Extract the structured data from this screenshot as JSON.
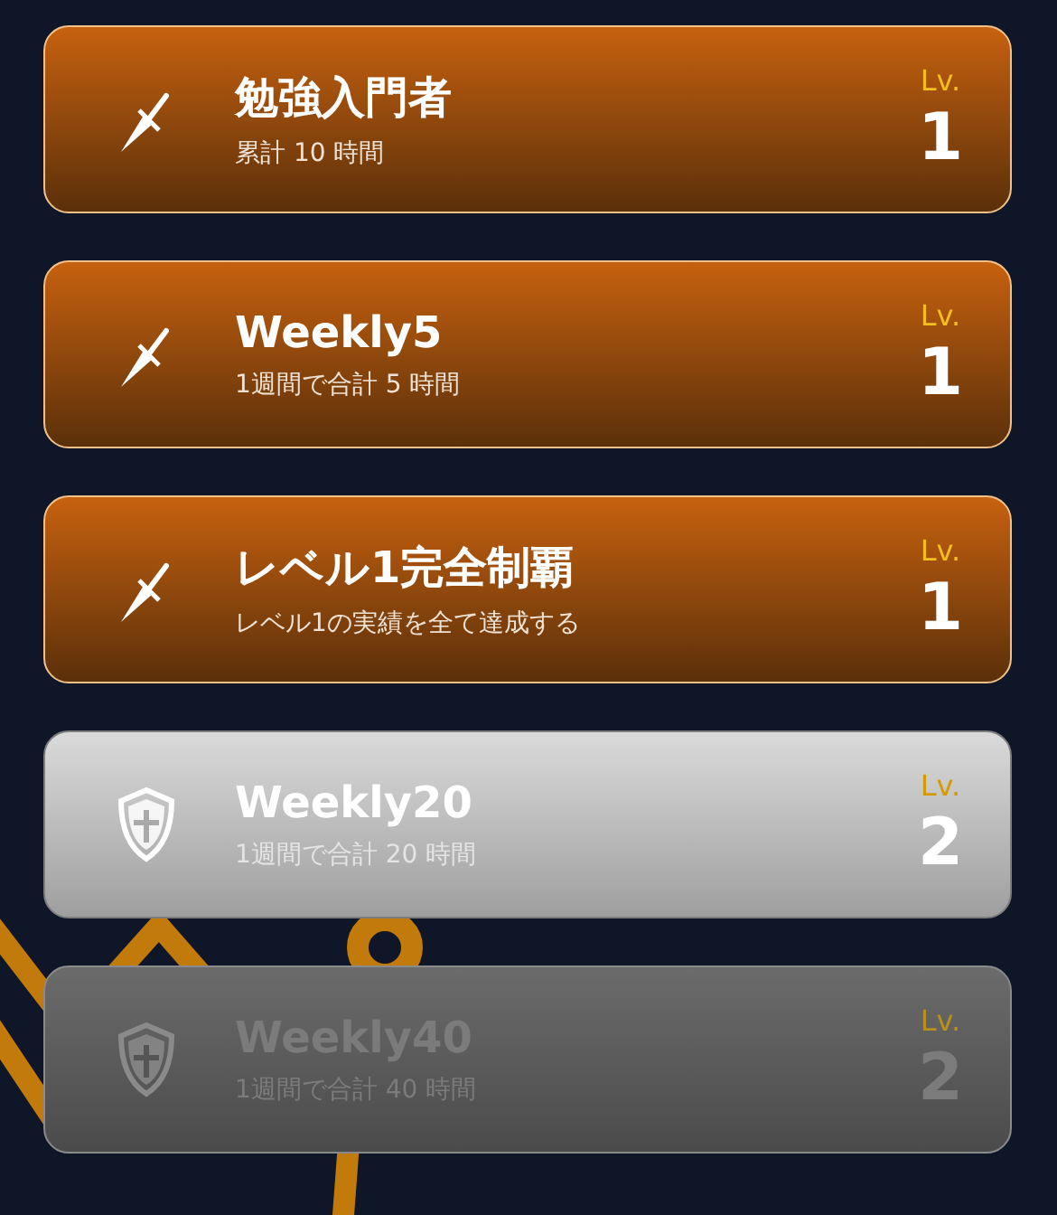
{
  "achievements": [
    {
      "kind": "bronze",
      "locked": false,
      "title": "勉強入門者",
      "description": "累計 10 時間",
      "level_label": "Lv.",
      "level": "1"
    },
    {
      "kind": "bronze",
      "locked": false,
      "title": "Weekly5",
      "description": "1週間で合計 5 時間",
      "level_label": "Lv.",
      "level": "1"
    },
    {
      "kind": "bronze",
      "locked": false,
      "title": "レベル1完全制覇",
      "description": "レベル1の実績を全て達成する",
      "level_label": "Lv.",
      "level": "1"
    },
    {
      "kind": "silver",
      "locked": false,
      "title": "Weekly20",
      "description": "1週間で合計 20 時間",
      "level_label": "Lv.",
      "level": "2"
    },
    {
      "kind": "silver",
      "locked": true,
      "title": "Weekly40",
      "description": "1週間で合計 40 時間",
      "level_label": "Lv.",
      "level": "2"
    }
  ]
}
